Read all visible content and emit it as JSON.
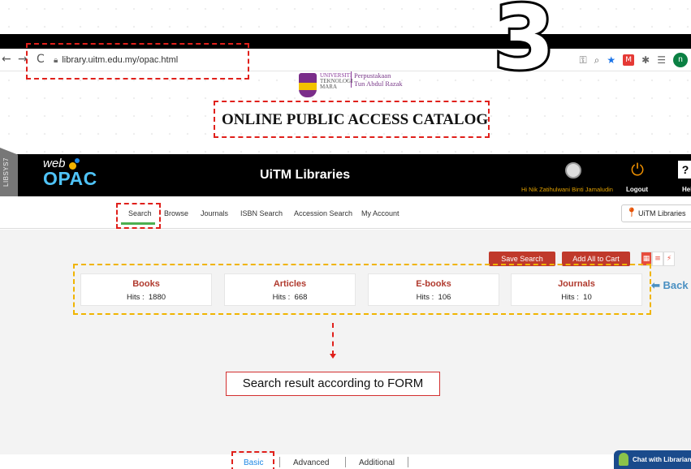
{
  "step_number": "3",
  "browser": {
    "back_glyph": "←",
    "forward_glyph": "→",
    "reload_glyph": "C",
    "url": "library.uitm.edu.my/opac.html",
    "icons": [
      "key-icon",
      "zoom-icon",
      "star-icon",
      "extension-icon",
      "puzzle-icon",
      "reading-list-icon",
      "profile-icon"
    ],
    "profile_initial": "n"
  },
  "logo": {
    "university_lines": [
      "UNIVERSITI",
      "TEKNOLOGI",
      "MARA"
    ],
    "library_lines": [
      "Perpustakaan",
      "Tun Abdul Razak"
    ]
  },
  "catalog_title": "ONLINE PUBLIC ACCESS CATALOG",
  "header": {
    "side_tab": "LIBSYS7",
    "brand_top": "web",
    "brand_bottom": "OPAC",
    "title": "UiTM Libraries",
    "user_greeting": "Hi Nik Zatihulwani Binti Jamaludin",
    "logout_label": "Logout",
    "help_label": "Hel"
  },
  "nav": {
    "items": [
      "Search",
      "Browse",
      "Journals",
      "ISBN Search",
      "Accession Search",
      "My Account"
    ],
    "library_select": "UiTM Libraries"
  },
  "actions": {
    "save_search": "Save Search",
    "add_all_to_cart": "Add All to Cart"
  },
  "categories": [
    {
      "name": "Books",
      "hits_label": "Hits :",
      "hits": "1880"
    },
    {
      "name": "Articles",
      "hits_label": "Hits :",
      "hits": "668"
    },
    {
      "name": "E-books",
      "hits_label": "Hits :",
      "hits": "106"
    },
    {
      "name": "Journals",
      "hits_label": "Hits :",
      "hits": "10"
    }
  ],
  "back_label": "Back",
  "annotation": "Search result according to FORM",
  "bottom_tabs": [
    "Basic",
    "Advanced",
    "Additional"
  ],
  "chat_label": "Chat with Librarian",
  "colors": {
    "accent_red": "#c0392b",
    "annotation_red": "#e0201b",
    "annotation_yellow": "#f0b400",
    "opac_blue": "#4fc3f7",
    "active_tab_blue": "#1e88e5"
  }
}
